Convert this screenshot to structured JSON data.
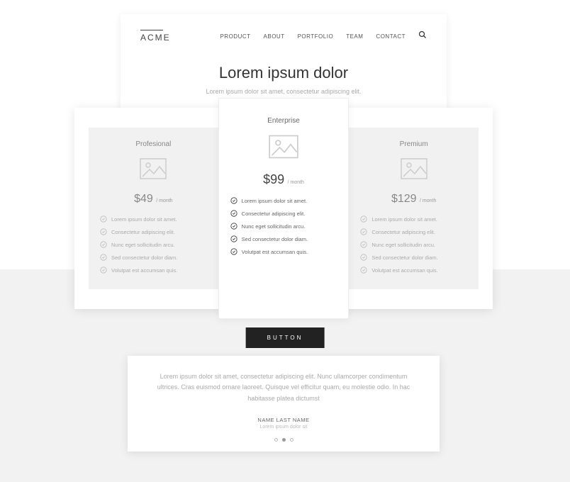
{
  "brand": "ACME",
  "nav": [
    "PRODUCT",
    "ABOUT",
    "PORTFOLIO",
    "TEAM",
    "CONTACT"
  ],
  "hero": {
    "title": "Lorem ipsum dolor",
    "subtitle": "Lorem ipsum dolor sit amet, consectetur adipiscing elit."
  },
  "pricing": [
    {
      "name": "Profesional",
      "price": "$49",
      "period": "/ month",
      "features": [
        "Lorem ipsum dolor sit amet.",
        "Consectetur adipiscing elit.",
        "Nunc eget sollicitudin arcu.",
        "Sed consectetur dolor diam.",
        "Volutpat est accumsan quis."
      ]
    },
    {
      "name": "Enterprise",
      "price": "$99",
      "period": "/ month",
      "features": [
        "Lorem ipsum dolor sit amet.",
        "Consectetur adipiscing elit.",
        "Nunc eget sollicitudin arcu.",
        "Sed consectetur dolor diam.",
        "Volutpat est accumsan quis."
      ]
    },
    {
      "name": "Premium",
      "price": "$129",
      "period": "/ month",
      "features": [
        "Lorem ipsum dolor sit amet.",
        "Consectetur adipiscing elit.",
        "Nunc eget sollicitudin arcu.",
        "Sed consectetur dolor diam.",
        "Volutpat est accumsan quis."
      ]
    }
  ],
  "cta_label": "BUTTON",
  "testimonial": {
    "text": "Lorem ipsum dolor sit amet, consectetur adipiscing elit. Nunc ullamcorper condimentum ultrices. Cras euismod ornare laoreet. Quisque vel efficitur quam, eu molestie odio. In hac habitasse platea dictumst",
    "name": "NAME LAST NAME",
    "role": "Lorem ipsum dolor sit"
  }
}
